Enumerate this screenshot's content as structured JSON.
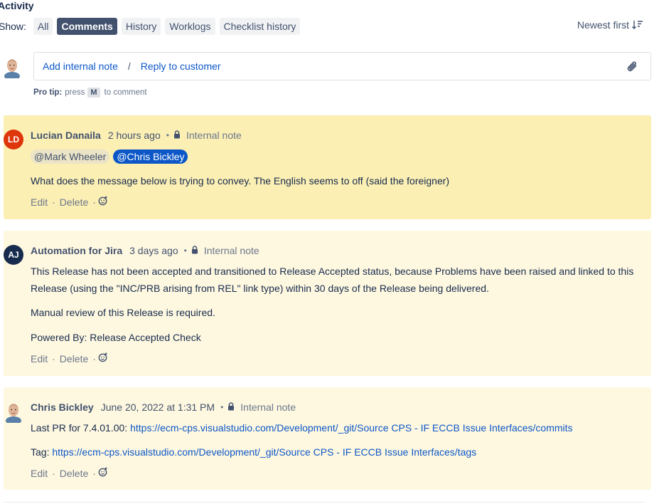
{
  "activity": {
    "title": "Activity",
    "show_label": "Show:",
    "filters": [
      "All",
      "Comments",
      "History",
      "Worklogs",
      "Checklist history"
    ],
    "active_filter": "Comments",
    "sort_label": "Newest first"
  },
  "composer": {
    "add_internal_note": "Add internal note",
    "separator": "/",
    "reply_to_customer": "Reply to customer",
    "protip_label": "Pro tip:",
    "protip_press": "press",
    "protip_key": "M",
    "protip_suffix": "to comment"
  },
  "comments": [
    {
      "author": "Lucian Danaila",
      "initials": "LD",
      "time": "2 hours ago",
      "visibility": "Internal note",
      "mentions": [
        "@Mark Wheeler",
        "@Chris Bickley"
      ],
      "paragraphs": [
        "What does the message below is trying to convey. The English seems to off (said the foreigner)"
      ],
      "edit": "Edit",
      "delete": "Delete"
    },
    {
      "author": "Automation for Jira",
      "initials": "AJ",
      "time": "3 days ago",
      "visibility": "Internal note",
      "paragraphs": [
        "This Release has not been accepted and transitioned to Release Accepted status, because Problems have been raised and linked to this Release (using the \"INC/PRB arising from REL\" link type) within 30 days of the Release being delivered.",
        "Manual review of this Release is required.",
        "Powered By: Release Accepted Check"
      ],
      "edit": "Edit",
      "delete": "Delete"
    },
    {
      "author": "Chris Bickley",
      "time": "June 20, 2022 at 1:31 PM",
      "visibility": "Internal note",
      "line1_prefix": "Last PR for 7.4.01.00: ",
      "line1_link": "https://ecm-cps.visualstudio.com/Development/_git/Source CPS - IF ECCB Issue Interfaces/commits",
      "line2_prefix": "Tag: ",
      "line2_link": "https://ecm-cps.visualstudio.com/Development/_git/Source CPS - IF ECCB Issue Interfaces/tags",
      "edit": "Edit",
      "delete": "Delete"
    }
  ],
  "colors": {
    "highlight_bg": "#fcefb4",
    "comment_bg": "#fff8e0",
    "link": "#0c57c7",
    "ld_avatar": "#de350b",
    "aj_avatar": "#172b4d"
  }
}
